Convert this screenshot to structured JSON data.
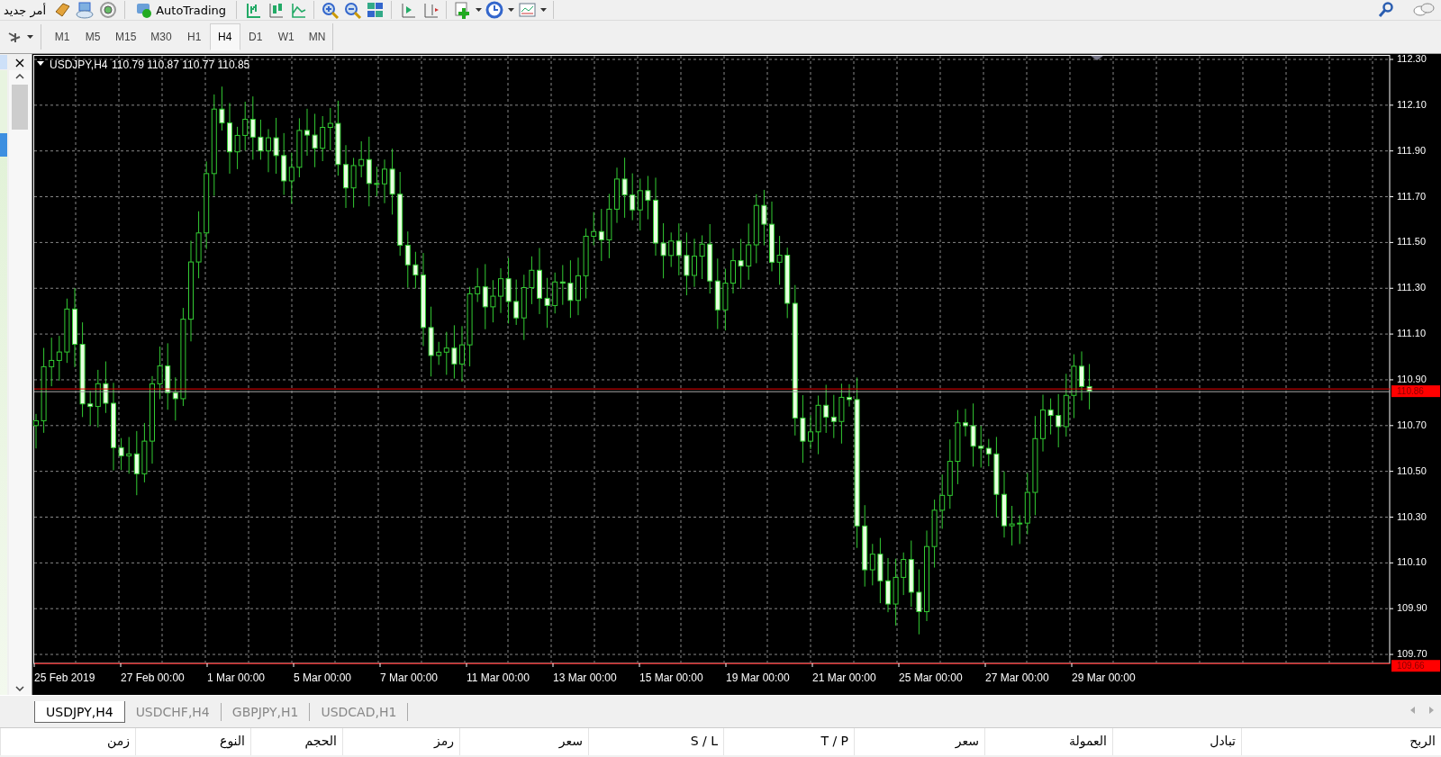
{
  "toolbar": {
    "new_order": "أمر جديد",
    "autotrading": "AutoTrading"
  },
  "timeframes": [
    {
      "label": "M1",
      "selected": false
    },
    {
      "label": "M5",
      "selected": false
    },
    {
      "label": "M15",
      "selected": false
    },
    {
      "label": "M30",
      "selected": false
    },
    {
      "label": "H1",
      "selected": false
    },
    {
      "label": "H4",
      "selected": true
    },
    {
      "label": "D1",
      "selected": false
    },
    {
      "label": "W1",
      "selected": false
    },
    {
      "label": "MN",
      "selected": false
    }
  ],
  "navigator": {
    "close": "×"
  },
  "chart": {
    "title": "USDJPY,H4",
    "ohlc": "110.79 110.87 110.77 110.85",
    "price_labels": [
      "112.30",
      "112.10",
      "111.90",
      "111.70",
      "111.50",
      "111.30",
      "111.10",
      "110.90",
      "110.70",
      "110.50",
      "110.30",
      "110.10",
      "109.90",
      "109.70"
    ],
    "time_labels": [
      "25 Feb 2019",
      "27 Feb 00:00",
      "1 Mar 00:00",
      "5 Mar 00:00",
      "7 Mar 00:00",
      "11 Mar 00:00",
      "13 Mar 00:00",
      "15 Mar 00:00",
      "19 Mar 00:00",
      "21 Mar 00:00",
      "25 Mar 00:00",
      "27 Mar 00:00",
      "29 Mar 00:00"
    ],
    "bid_line": "110.86",
    "level_line": "109.66"
  },
  "chart_tabs": [
    {
      "label": "USDJPY,H4",
      "selected": true
    },
    {
      "label": "USDCHF,H4",
      "selected": false
    },
    {
      "label": "GBPJPY,H1",
      "selected": false
    },
    {
      "label": "USDCAD,H1",
      "selected": false
    }
  ],
  "trade_columns": [
    "الربح",
    "تبادل",
    "العمولة",
    "سعر",
    "T / P",
    "S / L",
    "سعر",
    "رمز",
    "الحجم",
    "النوع",
    "زمن"
  ]
}
